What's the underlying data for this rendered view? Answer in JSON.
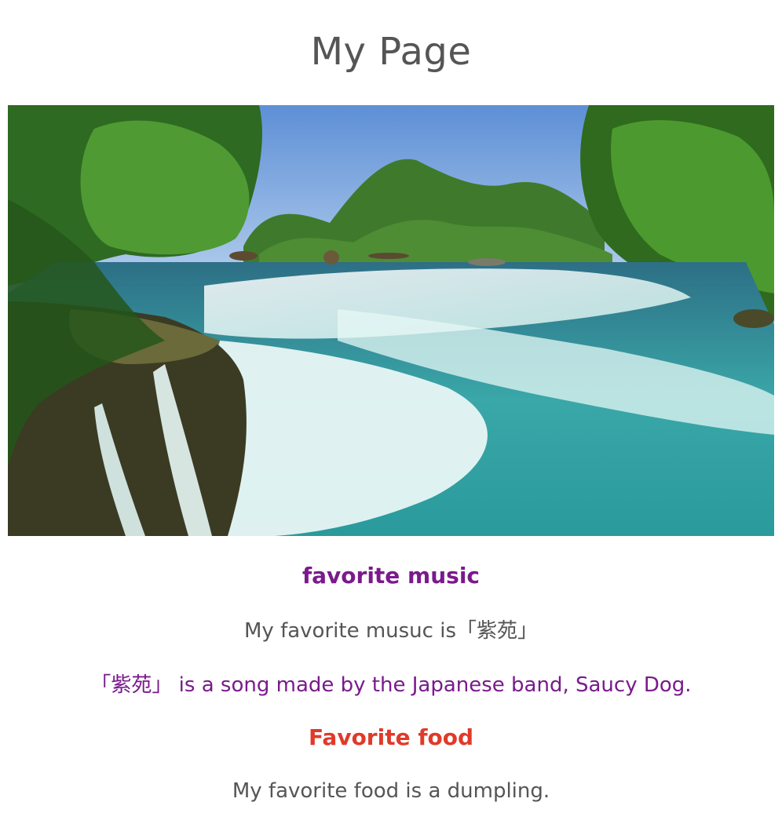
{
  "page": {
    "title": "My Page"
  },
  "hero_image": {
    "description_icon": "waterfall-photo"
  },
  "music_section": {
    "heading": "favorite music",
    "line1": "My favorite musuc is「紫苑」",
    "line2": "「紫苑」 is a song made by the Japanese band, Saucy Dog."
  },
  "food_section": {
    "heading": "Favorite food",
    "line1": "My favorite food is a dumpling."
  },
  "colors": {
    "body_text": "#555555",
    "music_heading": "#7a1a8c",
    "music_line2": "#7a1a8c",
    "food_heading": "#e03a2a"
  }
}
